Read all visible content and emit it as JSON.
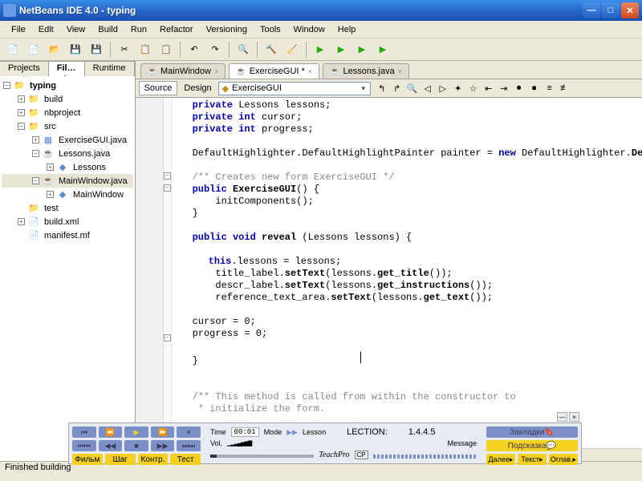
{
  "window": {
    "title": "NetBeans IDE 4.0 - typing"
  },
  "menu": [
    "File",
    "Edit",
    "View",
    "Build",
    "Run",
    "Refactor",
    "Versioning",
    "Tools",
    "Window",
    "Help"
  ],
  "panel_tabs": {
    "projects": "Projects",
    "files": "Fil…",
    "runtime": "Runtime"
  },
  "tree": {
    "root": "typing",
    "build": "build",
    "nbproject": "nbproject",
    "src": "src",
    "exercise": "ExerciseGUI.java",
    "lessons": "Lessons.java",
    "lessons_member": "Lessons",
    "mainwindow": "MainWindow.java",
    "mainwindow_member": "MainWindow",
    "test": "test",
    "buildxml": "build.xml",
    "manifest": "manifest.mf"
  },
  "editor": {
    "tabs": [
      "MainWindow",
      "ExerciseGUI *",
      "Lessons.java"
    ],
    "modes": {
      "source": "Source",
      "design": "Design"
    },
    "class_selector": {
      "icon": "◆",
      "value": "ExerciseGUI"
    },
    "code": {
      "l1": {
        "private": "private",
        "type1": "Lessons",
        "var1": "lessons;"
      },
      "l2": {
        "private": "private",
        "int": "int",
        "var": "cursor;"
      },
      "l3": {
        "private": "private",
        "int": "int",
        "var": "progress;"
      },
      "l4": {
        "p1": "DefaultHighlighter.DefaultHighlightPainter painter = ",
        "new": "new",
        "p2": " DefaultHighlighter.",
        "p3": "DefaultHighli"
      },
      "l5": {
        "cmt": "/** Creates new form ExerciseGUI */"
      },
      "l6": {
        "public": "public",
        "name": "ExerciseGUI",
        "paren": "() {"
      },
      "l7": {
        "body": "    initComponents();"
      },
      "l8": {
        "close": "}"
      },
      "l9": {
        "public": "public",
        "void": "void",
        "name": "reveal",
        "args": " (Lessons lessons) {"
      },
      "l10": {
        "thiskw": "this",
        "rest": ".lessons = lessons;"
      },
      "l11": {
        "pre": "    title_label.",
        "m": "setText",
        "mid": "(lessons.",
        "m2": "get_title",
        "tail": "());"
      },
      "l12": {
        "pre": "    descr_label.",
        "m": "setText",
        "mid": "(lessons.",
        "m2": "get_instructions",
        "tail": "());"
      },
      "l13": {
        "pre": "    reference_text_area.",
        "m": "setText",
        "mid": "(lessons.",
        "m2": "get_text",
        "tail": "());"
      },
      "l14": {
        "t": "cursor = 0;"
      },
      "l15": {
        "t": "progress = 0;"
      },
      "l16": {
        "close": "}"
      },
      "l17": {
        "cmt1": "/** This method is called from within the constructor to",
        "cmt2": " * initialize the form."
      }
    }
  },
  "status": {
    "text": "Finished building"
  },
  "player": {
    "time_label": "Time",
    "time_val": "00:01",
    "mode": "Mode",
    "lesson": "Lesson",
    "lection": "LECTION:",
    "lection_val": "1.4.4.5",
    "vol": "Vol.",
    "msg": "Message",
    "teach": "TeachPro",
    "btn_film": "Фильм",
    "btn_step": "Шаг",
    "btn_kontr": "Контр.",
    "btn_test": "Тест",
    "bookmarks": "Закладки",
    "hint": "Подсказка",
    "next": "Далее",
    "text": "Текст",
    "toc": "Оглав."
  }
}
